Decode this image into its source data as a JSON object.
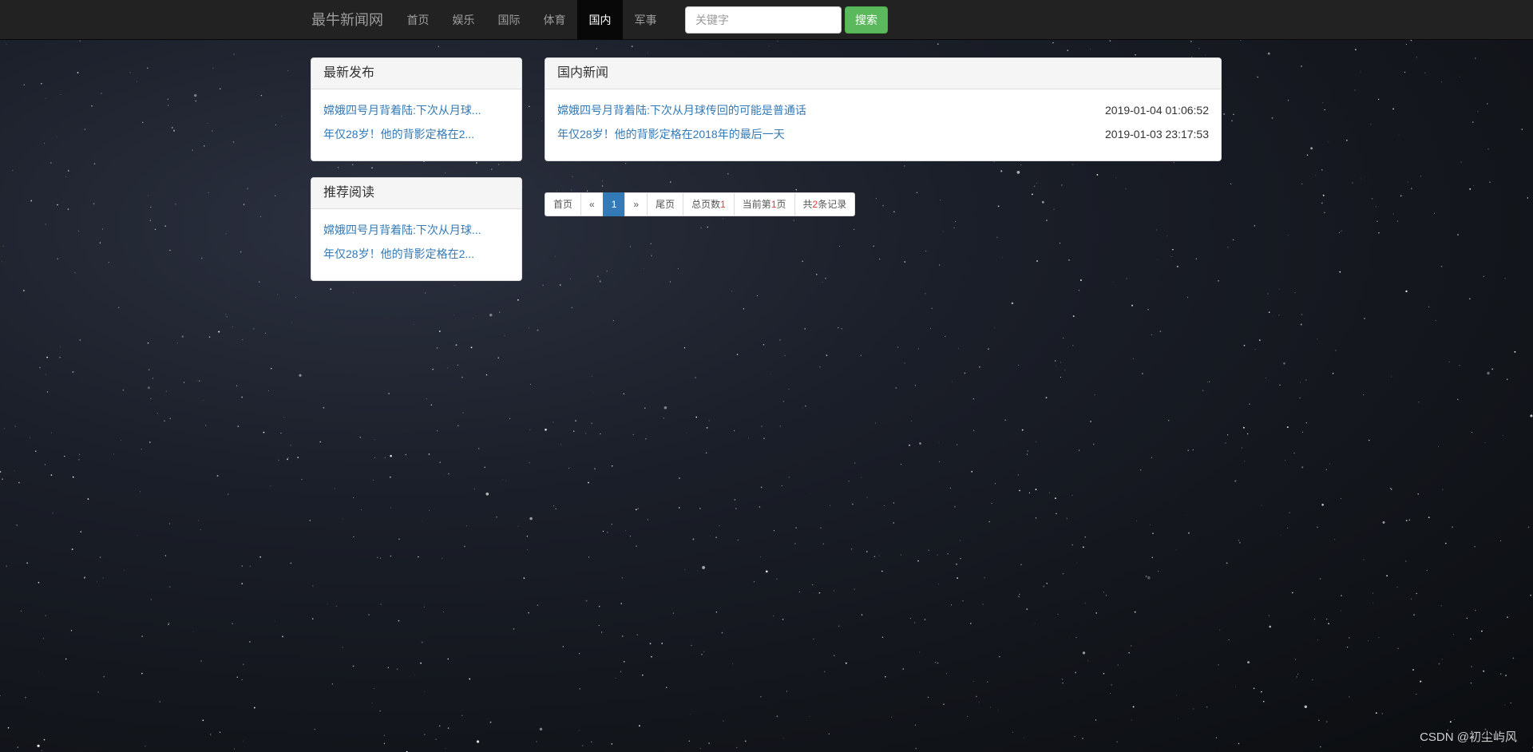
{
  "navbar": {
    "brand": "最牛新闻网",
    "items": [
      {
        "label": "首页"
      },
      {
        "label": "娱乐"
      },
      {
        "label": "国际"
      },
      {
        "label": "体育"
      },
      {
        "label": "国内",
        "active": true
      },
      {
        "label": "军事"
      }
    ],
    "search_placeholder": "关键字",
    "search_button": "搜索"
  },
  "sidebar": {
    "latest": {
      "title": "最新发布",
      "items": [
        "嫦娥四号月背着陆:下次从月球...",
        "年仅28岁！他的背影定格在2..."
      ]
    },
    "recommended": {
      "title": "推荐阅读",
      "items": [
        "嫦娥四号月背着陆:下次从月球...",
        "年仅28岁！他的背影定格在2..."
      ]
    }
  },
  "main": {
    "title": "国内新闻",
    "news": [
      {
        "title": "嫦娥四号月背着陆:下次从月球传回的可能是普通话",
        "time": "2019-01-04 01:06:52"
      },
      {
        "title": "年仅28岁！他的背影定格在2018年的最后一天",
        "time": "2019-01-03 23:17:53"
      }
    ]
  },
  "pagination": {
    "first": "首页",
    "prev": "«",
    "current": "1",
    "next": "»",
    "last": "尾页",
    "total_pages_label": "总页数",
    "total_pages": "1",
    "current_page_prefix": "当前第",
    "current_page": "1",
    "current_page_suffix": "页",
    "records_prefix": "共",
    "records": "2",
    "records_suffix": "条记录"
  },
  "watermark": "CSDN @初尘屿风",
  "colors": {
    "navbar_bg": "#222222",
    "link": "#337ab7",
    "search_button": "#5cb85c",
    "active_page": "#337ab7",
    "highlight_red": "#e4393c"
  }
}
